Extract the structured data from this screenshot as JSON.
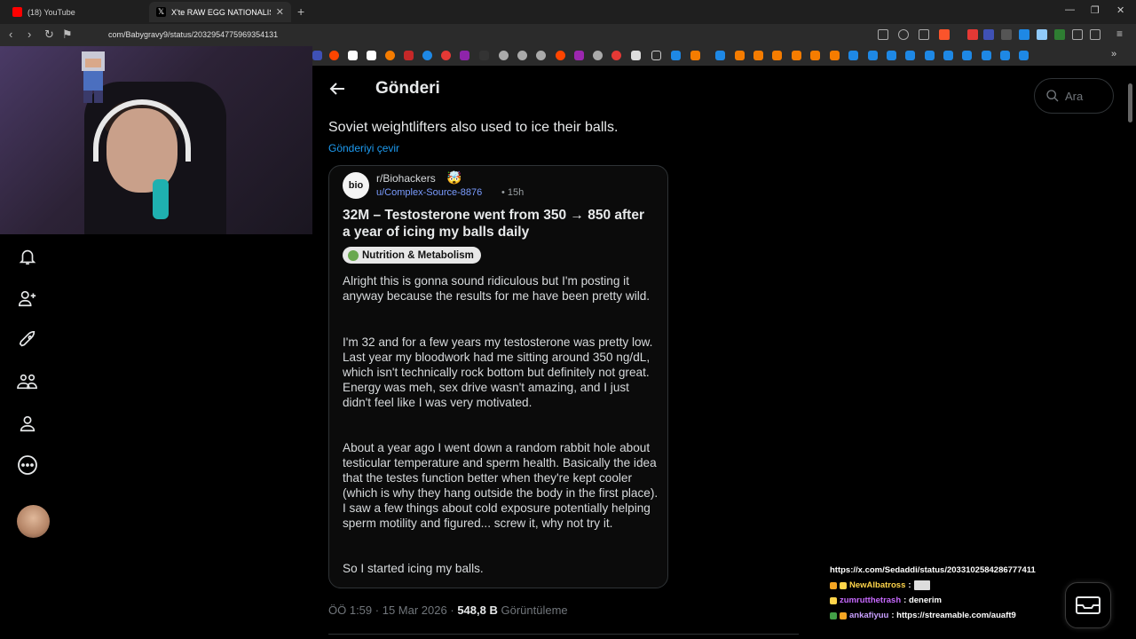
{
  "browser": {
    "tabs": [
      {
        "title": "(18) YouTube",
        "icon_color": "#ff0000"
      },
      {
        "title": "X'te RAW EGG NATIONALIST: \"S",
        "icon_color": "#ffffff"
      }
    ],
    "new_tab": "+",
    "url": "com/Babygravy9/status/2032954775969354131"
  },
  "post": {
    "header_title": "Gönderi",
    "text": "Soviet weightlifters also used to ice their balls.",
    "translate": "Gönderiyi çevir",
    "meta": {
      "time": "ÖÖ 1:59",
      "sep1": "·",
      "date": "15 Mar 2026",
      "sep2": "·",
      "views": "548,8 B",
      "views_label": "Görüntüleme"
    }
  },
  "reddit_card": {
    "subreddit_icon_text": "bio",
    "subreddit": "r/Biohackers",
    "user": "u/Complex-Source-8876",
    "time": "• 15h",
    "title": "32M – Testosterone went from 350 → 850 after a year of icing my balls daily",
    "flair": "Nutrition & Metabolism",
    "paragraphs": [
      "Alright this is gonna sound ridiculous but I'm posting it anyway because the results for me have been pretty wild.",
      "I'm 32 and for a few years my testosterone was pretty low. Last year my bloodwork had me sitting around 350 ng/dL, which isn't technically rock bottom but definitely not great. Energy was meh, sex drive wasn't amazing, and I just didn't feel like I was very motivated.",
      "About a year ago I went down a random rabbit hole about testicular temperature and sperm health. Basically the idea that the testes function better when they're kept cooler (which is why they hang outside the body in the first place). I saw a few things about cold exposure potentially helping sperm motility and figured... screw it, why not try it.",
      "So I started icing my balls."
    ]
  },
  "search": {
    "placeholder": "Ara"
  },
  "chat": [
    {
      "user": "",
      "text": "https://x.com/Sedaddi/status/2033102584286777411"
    },
    {
      "user": "NewAlbatross",
      "text": " : "
    },
    {
      "user": "zumrutthetrash",
      "text": " : denerim"
    },
    {
      "user": "ankafiyuu",
      "text": " : https://streamable.com/auaft9"
    }
  ],
  "colors": {
    "accent": "#1d9bf0",
    "bg": "#000000",
    "border": "#2f3336"
  }
}
